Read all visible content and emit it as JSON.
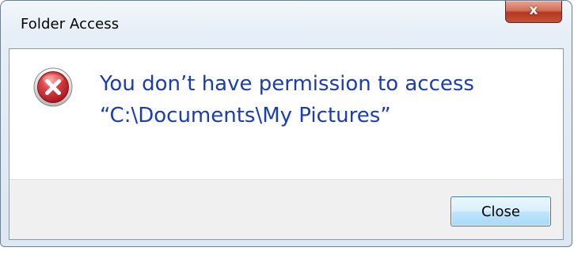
{
  "window": {
    "title": "Folder Access",
    "close_glyph": "x"
  },
  "dialog": {
    "icon": "error-icon",
    "message_line1": "You don’t have permission to access",
    "message_line2": "“C:\\Documents\\My Pictures”",
    "close_button_label": "Close"
  },
  "colors": {
    "message_text": "#1a3cb4",
    "error_icon_red": "#c1272d",
    "close_caption_red": "#c5533a",
    "button_border": "#3c7fb1"
  }
}
